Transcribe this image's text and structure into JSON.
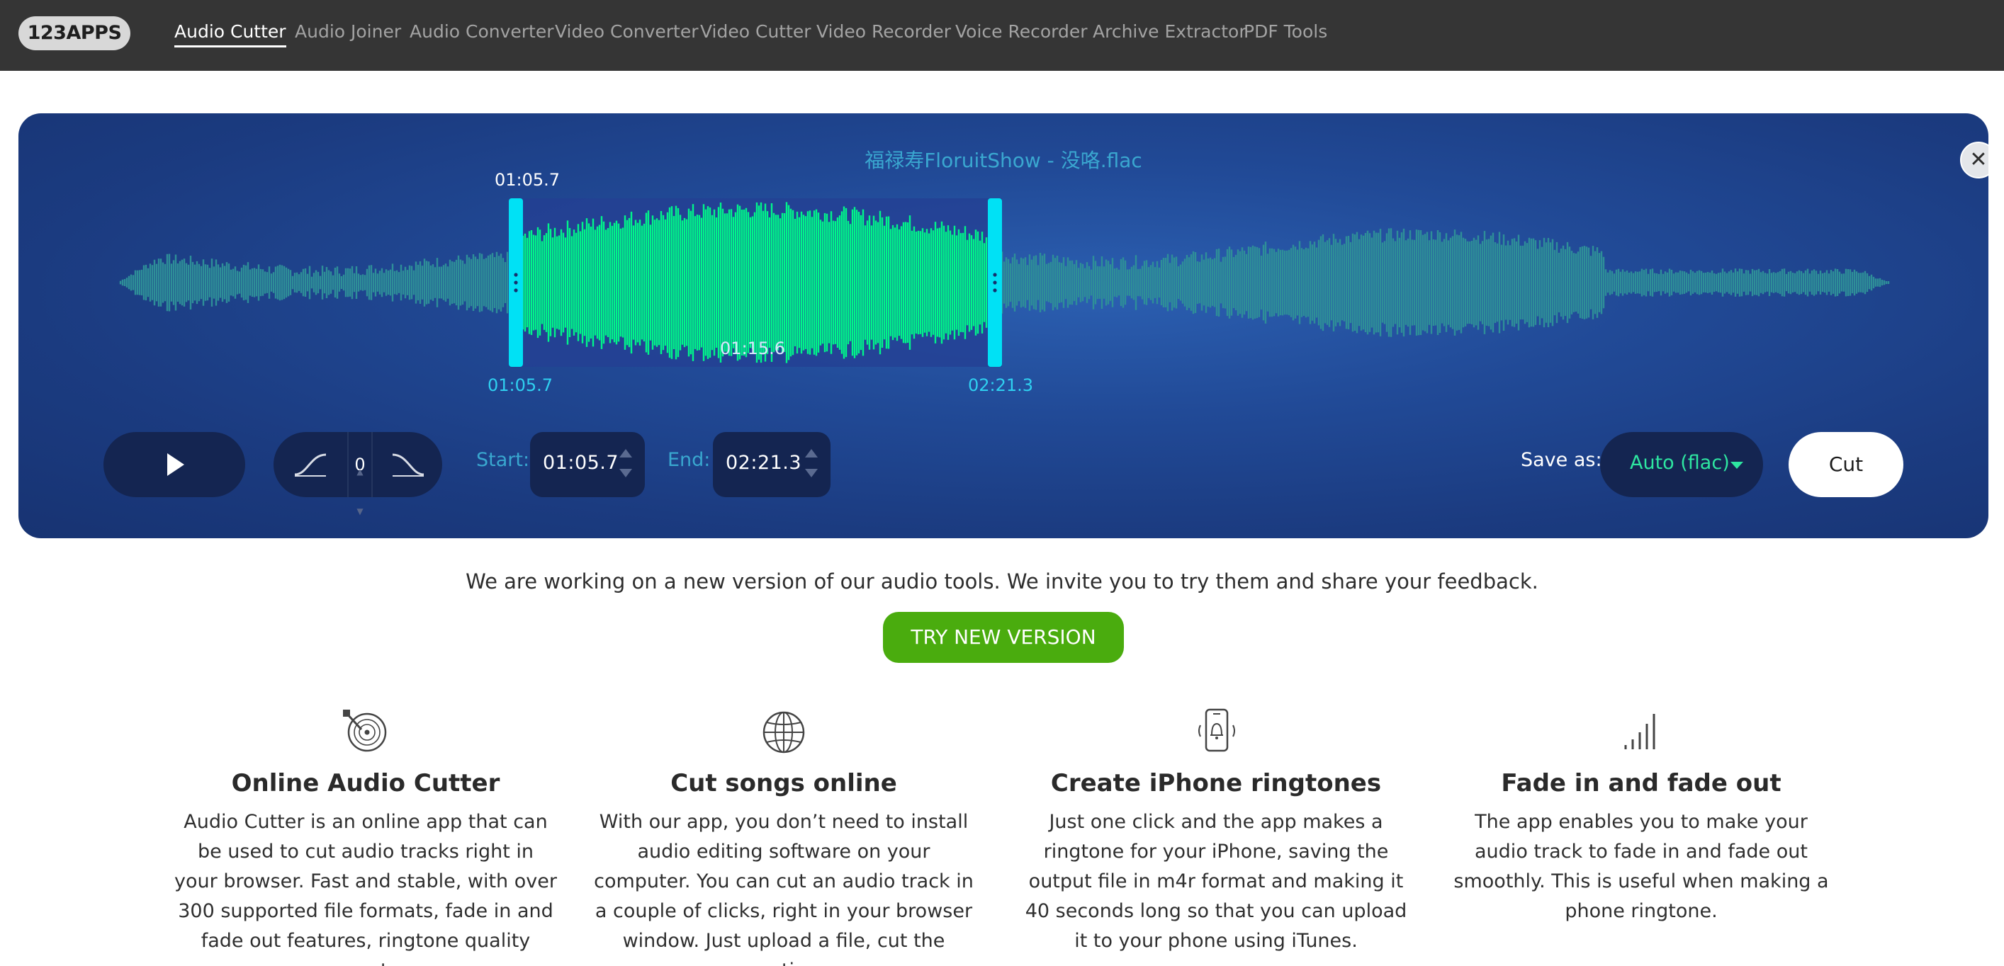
{
  "nav": {
    "logo": "123APPS",
    "items": [
      {
        "label": "Audio Cutter",
        "active": true
      },
      {
        "label": "Audio Joiner",
        "active": false
      },
      {
        "label": "Audio Converter",
        "active": false
      },
      {
        "label": "Video Converter",
        "active": false
      },
      {
        "label": "Video Cutter",
        "active": false
      },
      {
        "label": "Video Recorder",
        "active": false
      },
      {
        "label": "Voice Recorder",
        "active": false
      },
      {
        "label": "Archive Extractor",
        "active": false
      },
      {
        "label": "PDF Tools",
        "active": false
      }
    ]
  },
  "editor": {
    "filename": "福禄寿FloruitShow - 没咯.flac",
    "selection_top_time": "01:05.7",
    "selection_mid_time": "01:15.6",
    "selection_start_time": "01:05.7",
    "selection_end_time": "02:21.3",
    "fade_value": "0",
    "start_label": "Start:",
    "start_value": "01:05.7",
    "end_label": "End:",
    "end_value": "02:21.3",
    "save_as_label": "Save as:",
    "format_value": "Auto (flac)",
    "cut_label": "Cut",
    "close_glyph": "✕",
    "colors": {
      "selected_wave": "#00f58a",
      "unselected_wave": "#2e8f98",
      "handle": "#00e1f5",
      "format_text": "#2ee6a1"
    }
  },
  "notice": {
    "text": "We are working on a new version of our audio tools. We invite you to try them and share your feedback.",
    "button": "TRY NEW VERSION"
  },
  "features": [
    {
      "icon": "vinyl-record-icon",
      "title": "Online Audio Cutter",
      "description": "Audio Cutter is an online app that can be used to cut audio tracks right in your browser. Fast and stable, with over 300 supported file formats, fade in and fade out features, ringtone quality presets,"
    },
    {
      "icon": "globe-icon",
      "title": "Cut songs online",
      "description": "With our app, you don’t need to install audio editing software on your computer. You can cut an audio track in a couple of clicks, right in your browser window. Just upload a file, cut the section"
    },
    {
      "icon": "phone-ringtone-icon",
      "title": "Create iPhone ringtones",
      "description": "Just one click and the app makes a ringtone for your iPhone, saving the output file in m4r format and making it 40 seconds long so that you can upload it to your phone using iTunes."
    },
    {
      "icon": "fade-bars-icon",
      "title": "Fade in and fade out",
      "description": "The app enables you to make your audio track to fade in and fade out smoothly. This is useful when making a phone ringtone."
    }
  ]
}
